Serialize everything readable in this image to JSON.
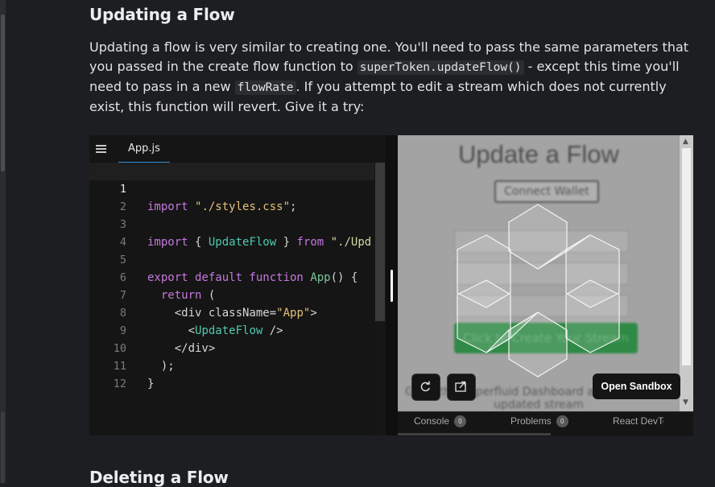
{
  "article": {
    "title": "Updating a Flow",
    "paragraph": {
      "t1": "Updating a flow is very similar to creating one. You'll need to pass the same parameters that you passed in the create flow function to ",
      "code1": "superToken.updateFlow()",
      "t2": " - except this time you'll need to pass in a new ",
      "code2": "flowRate",
      "t3": ". If you attempt to edit a stream which does not currently exist, this function will revert. Give it a try:"
    },
    "next_title": "Deleting a Flow"
  },
  "sandpack": {
    "file_tab": "App.js",
    "line_numbers": [
      "1",
      "2",
      "3",
      "4",
      "5",
      "6",
      "7",
      "8",
      "9",
      "10",
      "11",
      "12"
    ],
    "code": {
      "l1": {
        "kw": "import",
        "str": "\"./styles.css\"",
        "end": ";"
      },
      "l3": {
        "kw1": "import",
        "p1": " { ",
        "cmp": "UpdateFlow",
        "p2": " } ",
        "kw2": "from",
        "str": "\"./Upd"
      },
      "l5": {
        "kw1": "export default function",
        "fn": "App",
        "p": "() {"
      },
      "l6": {
        "kw": "return",
        "p": " ("
      },
      "l7": {
        "p1": "<div className=",
        "str": "\"App\"",
        "p2": ">"
      },
      "l8": {
        "p1": "<",
        "cmp": "UpdateFlow",
        "p2": " />"
      },
      "l9": {
        "p": "</div>"
      },
      "l10": {
        "p": ");"
      },
      "l11": {
        "p": "}"
      }
    },
    "preview": {
      "title": "Update a Flow",
      "connect_button": "Connect Wallet",
      "create_button": "Click to Create Your Stream",
      "bottom_text": "Go to the Superfluid Dashboard and look at the updated stream"
    },
    "open_sandbox_label": "Open Sandbox",
    "devtools_tabs": [
      {
        "label": "Console",
        "count": "0"
      },
      {
        "label": "Problems",
        "count": "0"
      },
      {
        "label": "React DevTools"
      }
    ]
  },
  "icons": {
    "menu": "hamburger-menu-icon",
    "refresh": "refresh-icon",
    "open_new": "open-in-new-window-icon",
    "loader": "hexagon-loader-icon"
  },
  "colors": {
    "background": "#1c1e21",
    "accent_tab": "#2f8fd8",
    "keyword": "#c678dd",
    "string": "#e5c07b",
    "component": "#4ec9b0",
    "create_button": "#2f8a45"
  }
}
